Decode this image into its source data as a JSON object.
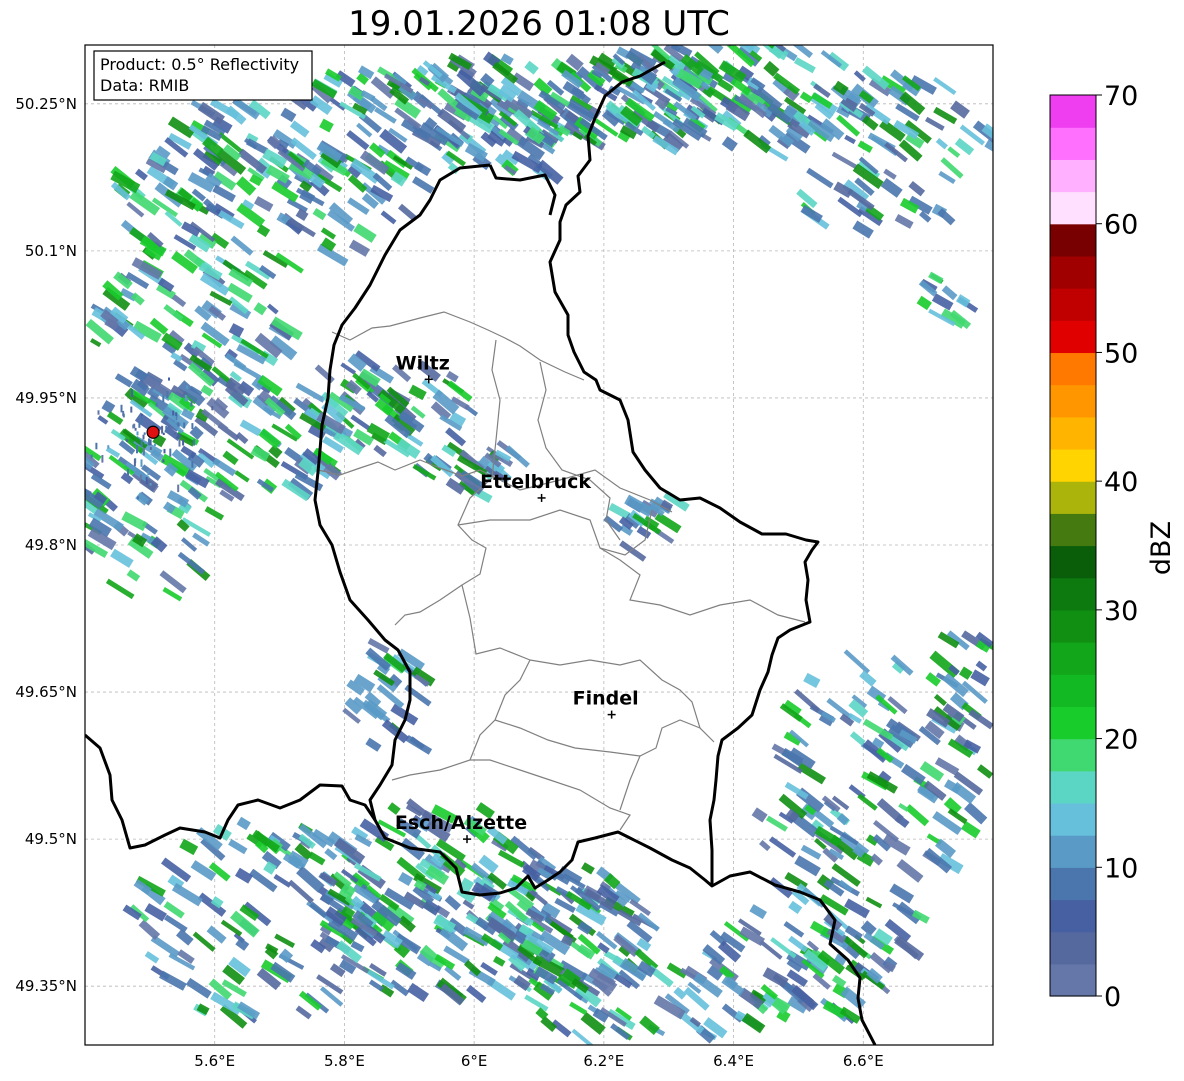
{
  "title": "19.01.2026 01:08 UTC",
  "info": {
    "product": "Product: 0.5° Reflectivity",
    "data": "Data: RMIB"
  },
  "map": {
    "lon_range": [
      5.4,
      6.8
    ],
    "lat_range": [
      49.29,
      50.31
    ],
    "lon_ticks": [
      {
        "value": 5.6,
        "label": "5.6°E"
      },
      {
        "value": 5.8,
        "label": "5.8°E"
      },
      {
        "value": 6.0,
        "label": "6°E"
      },
      {
        "value": 6.2,
        "label": "6.2°E"
      },
      {
        "value": 6.4,
        "label": "6.4°E"
      },
      {
        "value": 6.6,
        "label": "6.6°E"
      }
    ],
    "lat_ticks": [
      {
        "value": 49.35,
        "label": "49.35°N"
      },
      {
        "value": 49.5,
        "label": "49.5°N"
      },
      {
        "value": 49.65,
        "label": "49.65°N"
      },
      {
        "value": 49.8,
        "label": "49.8°N"
      },
      {
        "value": 49.95,
        "label": "49.95°N"
      },
      {
        "value": 50.1,
        "label": "50.1°N"
      },
      {
        "value": 50.25,
        "label": "50.25°N"
      }
    ],
    "cities": [
      {
        "name": "Wiltz",
        "lon": 5.93,
        "lat": 49.969
      },
      {
        "name": "Ettelbruck",
        "lon": 6.104,
        "lat": 49.848
      },
      {
        "name": "Findel",
        "lon": 6.212,
        "lat": 49.627
      },
      {
        "name": "Esch/Alzette",
        "lon": 5.989,
        "lat": 49.5
      }
    ],
    "radar_site": {
      "lon": 5.505,
      "lat": 49.915
    }
  },
  "colorbar": {
    "label": "dBZ",
    "min": 0,
    "max": 70,
    "ticks": [
      {
        "value": 0,
        "label": "0"
      },
      {
        "value": 10,
        "label": "10"
      },
      {
        "value": 20,
        "label": "20"
      },
      {
        "value": 30,
        "label": "30"
      },
      {
        "value": 40,
        "label": "40"
      },
      {
        "value": 50,
        "label": "50"
      },
      {
        "value": 60,
        "label": "60"
      },
      {
        "value": 70,
        "label": "70"
      }
    ],
    "colors": [
      "#6577a8",
      "#55699f",
      "#4660a2",
      "#4a76ad",
      "#5a9ac6",
      "#66c0dc",
      "#5cd6c4",
      "#40d870",
      "#18cc2c",
      "#12b922",
      "#12a61a",
      "#108f12",
      "#0d7a10",
      "#0a5e0a",
      "#447a10",
      "#aab40a",
      "#ffd400",
      "#ffb400",
      "#ff9600",
      "#ff7800",
      "#e00000",
      "#c00000",
      "#a00000",
      "#780000",
      "#ffe0ff",
      "#ffb0ff",
      "#ff70ff",
      "#ee3ef0"
    ]
  }
}
